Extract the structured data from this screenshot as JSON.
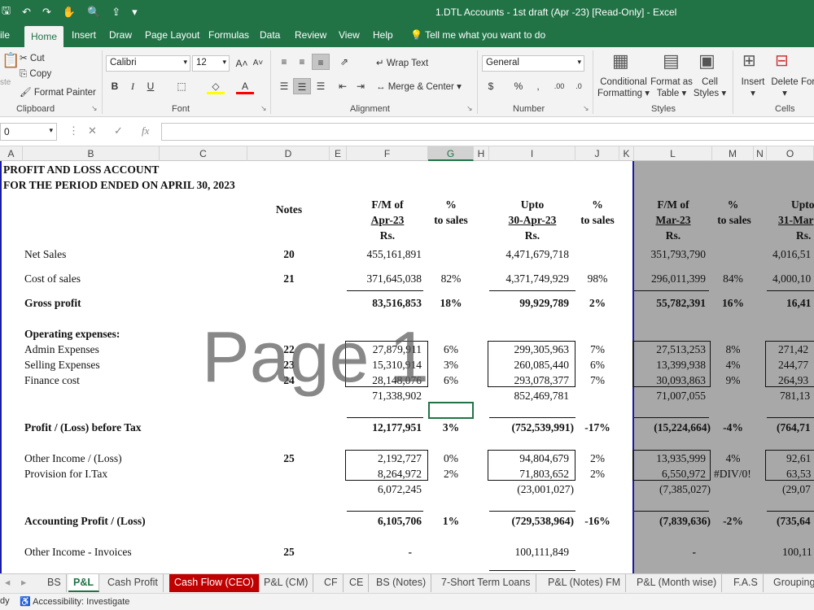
{
  "window": {
    "title": "1.DTL Accounts - 1st draft (Apr -23)  [Read-Only]  -  Excel"
  },
  "ribbon_tabs": [
    "ile",
    "Home",
    "Insert",
    "Draw",
    "Page Layout",
    "Formulas",
    "Data",
    "Review",
    "View",
    "Help"
  ],
  "tell_me": "Tell me what you want to do",
  "clipboard": {
    "paste": "ste",
    "cut": "Cut",
    "copy": "Copy",
    "format_painter": "Format Painter",
    "group": "Clipboard"
  },
  "font": {
    "name": "Calibri",
    "size": "12",
    "group": "Font"
  },
  "alignment": {
    "wrap_text": "Wrap Text",
    "merge_center": "Merge & Center",
    "group": "Alignment"
  },
  "number": {
    "format": "General",
    "group": "Number"
  },
  "styles": {
    "conditional_formatting_1": "Conditional",
    "conditional_formatting_2": "Formatting",
    "format_as_table_1": "Format as",
    "format_as_table_2": "Table",
    "cell_styles_1": "Cell",
    "cell_styles_2": "Styles",
    "group": "Styles"
  },
  "cells": {
    "insert": "Insert",
    "delete": "Delete",
    "format": "For",
    "group": "Cells"
  },
  "formula_bar": {
    "name_box": "0",
    "formula": ""
  },
  "columns": [
    "A",
    "B",
    "C",
    "D",
    "E",
    "F",
    "G",
    "H",
    "I",
    "J",
    "K",
    "L",
    "M",
    "N",
    "O"
  ],
  "report": {
    "title1": "PROFIT AND LOSS ACCOUNT",
    "title2": "FOR THE PERIOD ENDED ON APRIL 30, 2023",
    "notes": "Notes",
    "fm_of": "F/M of",
    "apr23": "Apr-23",
    "pct": "%",
    "to_sales": "to sales",
    "upto": "Upto",
    "upto_date": "30-Apr-23",
    "rs": "Rs.",
    "fm_of2": "F/M of",
    "mar23": "Mar-23",
    "pct2": "%",
    "to_sales2": "to sales",
    "upto2": "Upto",
    "upto_date2": "31-Mar",
    "rs2": "Rs.",
    "rs3": "Rs.",
    "net_sales": {
      "label": "Net Sales",
      "note": "20",
      "f": "455,161,891",
      "i": "4,471,679,718",
      "l": "351,793,790",
      "o": "4,016,51"
    },
    "cost_of_sales": {
      "label": "Cost of sales",
      "note": "21",
      "f": "371,645,038",
      "g": "82%",
      "i": "4,371,749,929",
      "j": "98%",
      "l": "296,011,399",
      "m": "84%",
      "o": "4,000,10"
    },
    "gross_profit": {
      "label": "Gross profit",
      "f": "83,516,853",
      "g": "18%",
      "i": "99,929,789",
      "j": "2%",
      "l": "55,782,391",
      "m": "16%",
      "o": "16,41"
    },
    "opex_heading": "Operating expenses:",
    "admin": {
      "label": "Admin Expenses",
      "note": "22",
      "f": "27,879,911",
      "g": "6%",
      "i": "299,305,963",
      "j": "7%",
      "l": "27,513,253",
      "m": "8%",
      "o": "271,42"
    },
    "selling": {
      "label": "Selling Expenses",
      "note": "23",
      "f": "15,310,914",
      "g": "3%",
      "i": "260,085,440",
      "j": "6%",
      "l": "13,399,938",
      "m": "4%",
      "o": "244,77"
    },
    "finance": {
      "label": "Finance cost",
      "note": "24",
      "f": "28,148,076",
      "g": "6%",
      "i": "293,078,377",
      "j": "7%",
      "l": "30,093,863",
      "m": "9%",
      "o": "264,93"
    },
    "opex_total": {
      "f": "71,338,902",
      "i": "852,469,781",
      "l": "71,007,055",
      "o": "781,13"
    },
    "pbt": {
      "label": "Profit / (Loss) before Tax",
      "f": "12,177,951",
      "g": "3%",
      "i": "(752,539,991)",
      "j": "-17%",
      "l": "(15,224,664)",
      "m": "-4%",
      "o": "(764,71"
    },
    "other_income": {
      "label": "Other Income / (Loss)",
      "note": "25",
      "f": "2,192,727",
      "g": "0%",
      "i": "94,804,679",
      "j": "2%",
      "l": "13,935,999",
      "m": "4%",
      "o": "92,61"
    },
    "provision_tax": {
      "label": "Provision for I.Tax",
      "f": "8,264,972",
      "g": "2%",
      "i": "71,803,652",
      "j": "2%",
      "l": "6,550,972",
      "m": "#DIV/0!",
      "o": "63,53"
    },
    "oi_total": {
      "f": "6,072,245",
      "i": "(23,001,027)",
      "l": "(7,385,027)",
      "o": "(29,07"
    },
    "accounting_profit": {
      "label": "Accounting Profit / (Loss)",
      "f": "6,105,706",
      "g": "1%",
      "i": "(729,538,964)",
      "j": "-16%",
      "l": "(7,839,636)",
      "m": "-2%",
      "o": "(735,64"
    },
    "oi_invoices": {
      "label": "Other Income - Invoices",
      "note": "25",
      "f": "-",
      "i": "100,111,849",
      "l": "-",
      "o": "100,11"
    }
  },
  "watermark": "Page 1",
  "sheet_tabs": [
    "BS",
    "P&L",
    "Cash Profit",
    "Cash Flow (CEO)",
    "P&L (CM)",
    "CF",
    "CE",
    "BS (Notes)",
    "7-Short Term Loans",
    "P&L (Notes) FM",
    "P&L (Month wise)",
    "F.A.S",
    "Grouping"
  ],
  "status": {
    "ready": "dy",
    "accessibility": "Accessibility: Investigate"
  },
  "colors": {
    "excel_green": "#217346",
    "page_break": "#1a1aa8",
    "red_tab": "#c00000"
  }
}
